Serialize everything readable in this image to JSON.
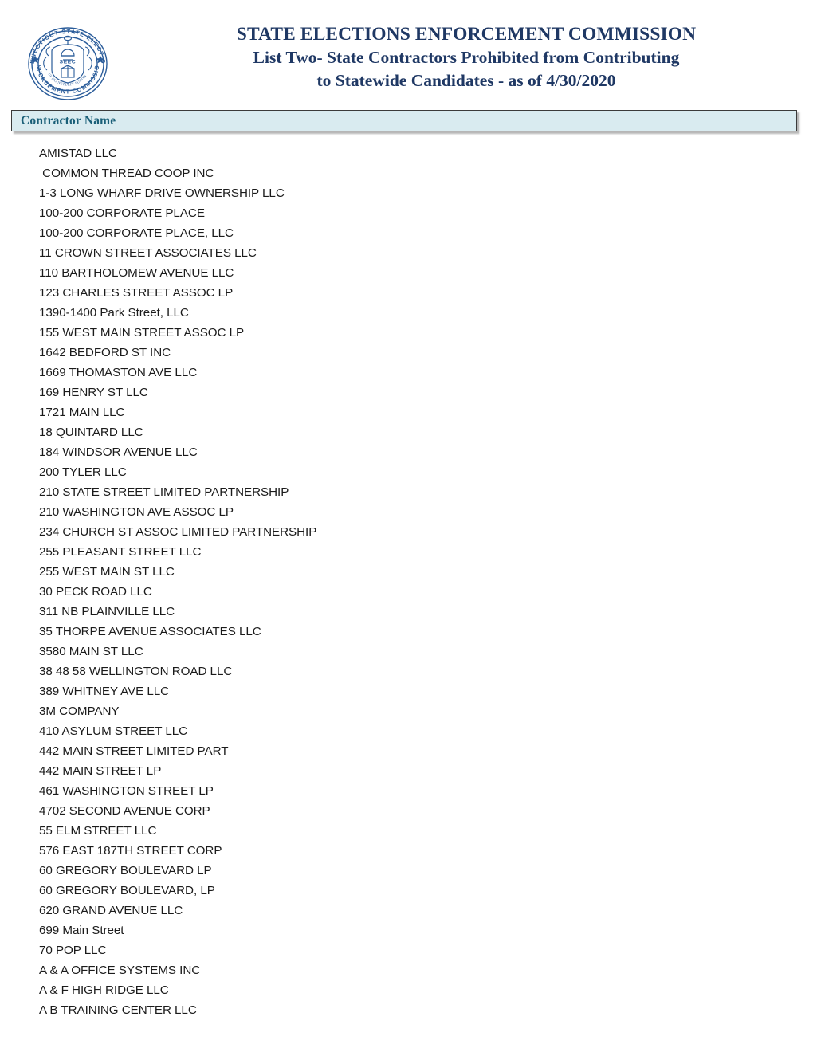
{
  "header": {
    "seal": {
      "icon": "seec-seal-icon",
      "outer_text_top": "CONNECTICUT STATE ELECTIONS",
      "outer_text_bottom": "ENFORCEMENT COMMISSION",
      "center_text": "SEEC",
      "color": "#2a5c9a"
    },
    "title_line_1": "STATE ELECTIONS ENFORCEMENT COMMISSION",
    "title_line_2": "List Two- State Contractors Prohibited from Contributing",
    "title_line_3": "to Statewide Candidates - as of 4/30/2020",
    "title_color": "#1f3864"
  },
  "table": {
    "column_header": "Contractor Name",
    "column_header_color": "#1a5f78",
    "column_header_background": "#d9ebf0",
    "rows": [
      "AMISTAD LLC",
      " COMMON THREAD COOP INC",
      "1-3 LONG WHARF DRIVE OWNERSHIP LLC",
      "100-200 CORPORATE PLACE",
      "100-200 CORPORATE PLACE, LLC",
      "11 CROWN STREET ASSOCIATES LLC",
      "110 BARTHOLOMEW AVENUE LLC",
      "123 CHARLES STREET ASSOC LP",
      "1390-1400 Park Street, LLC",
      "155 WEST MAIN STREET ASSOC LP",
      "1642 BEDFORD ST INC",
      "1669 THOMASTON AVE LLC",
      "169 HENRY ST LLC",
      "1721 MAIN LLC",
      "18 QUINTARD LLC",
      "184 WINDSOR AVENUE LLC",
      "200 TYLER LLC",
      "210 STATE STREET LIMITED PARTNERSHIP",
      "210 WASHINGTON AVE ASSOC LP",
      "234 CHURCH ST ASSOC LIMITED PARTNERSHIP",
      "255 PLEASANT STREET LLC",
      "255 WEST MAIN ST LLC",
      "30 PECK ROAD LLC",
      "311 NB PLAINVILLE LLC",
      "35 THORPE AVENUE ASSOCIATES LLC",
      "3580 MAIN ST LLC",
      "38 48 58 WELLINGTON ROAD LLC",
      "389 WHITNEY AVE LLC",
      "3M COMPANY",
      "410 ASYLUM STREET LLC",
      "442 MAIN STREET LIMITED PART",
      "442 MAIN STREET LP",
      "461 WASHINGTON STREET LP",
      "4702 SECOND AVENUE CORP",
      "55 ELM STREET LLC",
      "576 EAST 187TH STREET CORP",
      "60 GREGORY BOULEVARD LP",
      "60 GREGORY BOULEVARD, LP",
      "620 GRAND AVENUE LLC",
      "699 Main Street",
      "70 POP LLC",
      "A & A OFFICE SYSTEMS INC",
      "A & F HIGH RIDGE LLC",
      "A B TRAINING CENTER LLC"
    ]
  }
}
